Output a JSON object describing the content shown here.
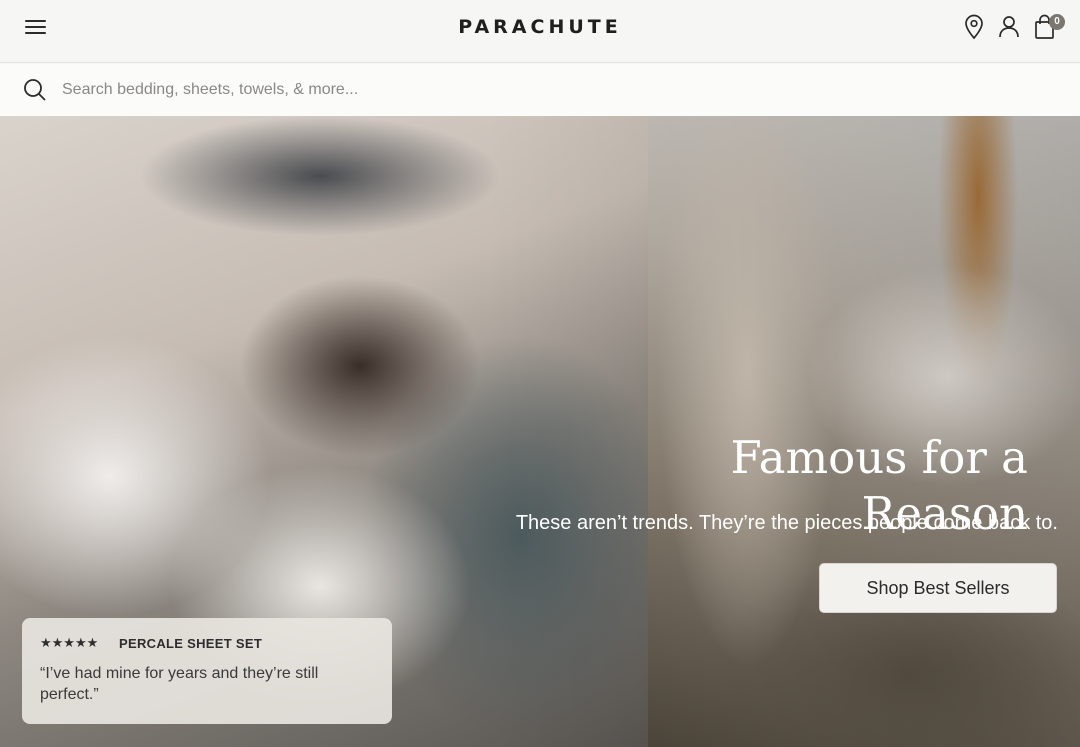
{
  "header": {
    "brand": "PARACHUTE",
    "cart_count": "0",
    "icons": [
      "menu-icon",
      "location-pin-icon",
      "account-icon",
      "shopping-bag-icon"
    ]
  },
  "search": {
    "placeholder": "Search bedding, sheets, towels, & more..."
  },
  "hero": {
    "title": "Famous for a Reason",
    "subtitle": "These aren’t trends. They’re the pieces people come back to.",
    "cta_label": "Shop Best Sellers"
  },
  "review": {
    "rating": 5,
    "stars": "★★★★★",
    "product": "PERCALE SHEET SET",
    "quote": "“I’ve had mine for years and they’re still perfect.”"
  },
  "colors": {
    "header_bg": "#f6f6f5",
    "text": "#2b2b2b",
    "badge": "#7b7670",
    "cta_bg": "#f3f1ee"
  }
}
